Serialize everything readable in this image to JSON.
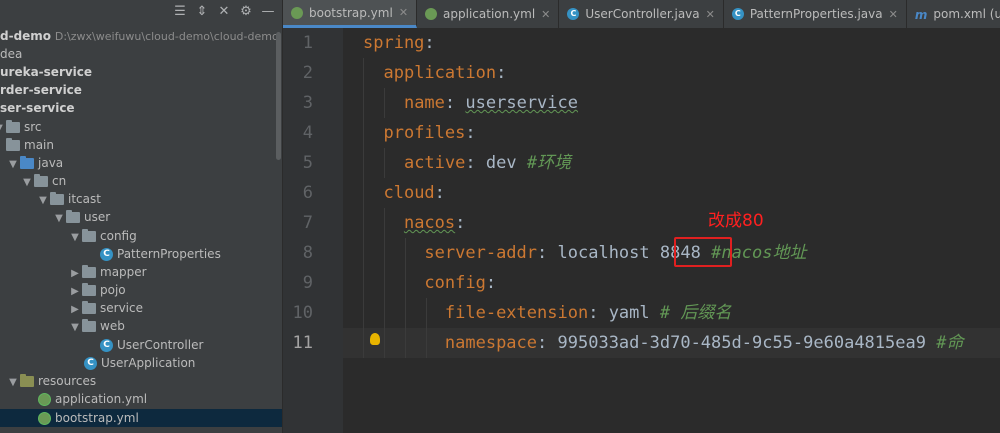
{
  "project": {
    "root_name": "d-demo",
    "root_path": "D:\\zwx\\weifuwu\\cloud-demo\\cloud-demo",
    "items": [
      {
        "label": "dea",
        "bold": false
      },
      {
        "label": "ureka-service",
        "bold": true
      },
      {
        "label": "rder-service",
        "bold": true
      },
      {
        "label": "ser-service",
        "bold": true
      },
      {
        "label": "src"
      },
      {
        "label": "main"
      },
      {
        "label": "java"
      },
      {
        "label": "cn"
      },
      {
        "label": "itcast"
      },
      {
        "label": "user"
      },
      {
        "label": "config"
      },
      {
        "label": "PatternProperties"
      },
      {
        "label": "mapper"
      },
      {
        "label": "pojo"
      },
      {
        "label": "service"
      },
      {
        "label": "web"
      },
      {
        "label": "UserController"
      },
      {
        "label": "UserApplication"
      },
      {
        "label": "resources"
      },
      {
        "label": "application.yml"
      },
      {
        "label": "bootstrap.yml"
      }
    ]
  },
  "tabs": [
    {
      "label": "bootstrap.yml",
      "icon": "yaml-spring-icon",
      "active": true
    },
    {
      "label": "application.yml",
      "icon": "yaml-spring-icon",
      "active": false
    },
    {
      "label": "UserController.java",
      "icon": "java-class-icon",
      "active": false
    },
    {
      "label": "PatternProperties.java",
      "icon": "java-class-icon",
      "active": false
    },
    {
      "label": "pom.xml (user-service)",
      "icon": "maven-icon",
      "active": false
    }
  ],
  "code": {
    "line_numbers": [
      "1",
      "2",
      "3",
      "4",
      "5",
      "6",
      "7",
      "8",
      "9",
      "10",
      "11"
    ],
    "l1": {
      "key": "spring",
      "punct": ":"
    },
    "l2": {
      "key": "application",
      "punct": ":"
    },
    "l3": {
      "key": "name",
      "punct": ":",
      "value": "userservice"
    },
    "l4": {
      "key": "profiles",
      "punct": ":"
    },
    "l5": {
      "key": "active",
      "punct": ":",
      "value": "dev",
      "comment": "#环境"
    },
    "l6": {
      "key": "cloud",
      "punct": ":"
    },
    "l7": {
      "key": "nacos",
      "punct": ":"
    },
    "l8": {
      "key": "server-addr",
      "punct": ":",
      "value_host": "localhost",
      "value_port": "8848",
      "comment": "#nacos地址"
    },
    "l9": {
      "key": "config",
      "punct": ":"
    },
    "l10": {
      "key": "file-extension",
      "punct": ":",
      "value": "yaml",
      "comment": "# 后缀名"
    },
    "l11": {
      "key": "namespace",
      "punct": ":",
      "value": "995033ad-3d70-485d-9c55-9e60a4815ea9",
      "comment": "#命"
    }
  },
  "annotation": {
    "text": "改成80",
    "color": "#ff2020"
  },
  "colors": {
    "key": "#cc7832",
    "comment": "#629755",
    "text": "#a9b7c6",
    "background": "#2b2b2b"
  }
}
